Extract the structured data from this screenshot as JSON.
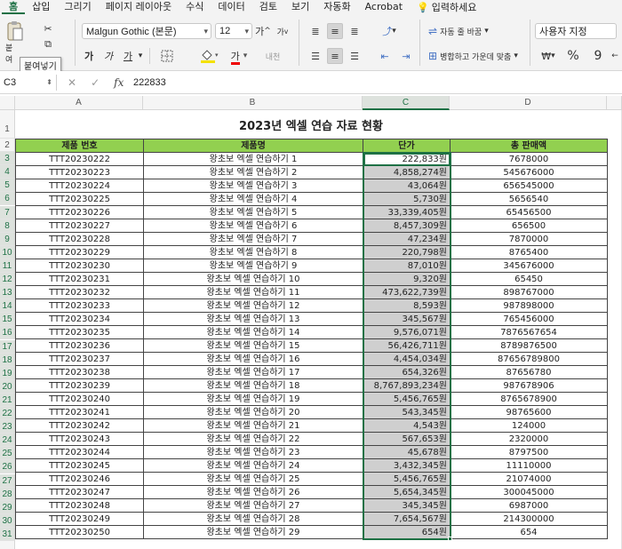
{
  "ribbon": {
    "tabs": [
      "홈",
      "삽입",
      "그리기",
      "페이지 레이아웃",
      "수식",
      "데이터",
      "검토",
      "보기",
      "자동화",
      "Acrobat"
    ],
    "active_tab": 0,
    "search_label": "입력하세요",
    "font_name": "Malgun Gothic (본문)",
    "font_size": "12",
    "grow_font": "가",
    "shrink_font": "가",
    "bold": "가",
    "italic": "가",
    "underline": "가",
    "font_color_letter": "가",
    "phonetic": "내천",
    "wrap_text_label": "자동 줄 바꿈",
    "merge_center_label": "병합하고 가운데 맞춤",
    "number_format": "사용자 지정",
    "paste_label": "붙여",
    "tooltip": "붙여넣기",
    "percent": "%",
    "comma": "9",
    "accent_color": "#1e7145"
  },
  "formula_bar": {
    "cell_ref": "C3",
    "fx": "fx",
    "value": "222833"
  },
  "columns": [
    "A",
    "B",
    "C",
    "D"
  ],
  "sheet": {
    "title": "2023년 엑셀 연습 자료 현황",
    "headers": [
      "제품 번호",
      "제품명",
      "단가",
      "총 판매액"
    ],
    "rows": [
      [
        "TTT20230222",
        "왕초보 엑셀 연습하기 1",
        "222,833원",
        "7678000"
      ],
      [
        "TTT20230223",
        "왕초보 엑셀 연습하기 2",
        "4,858,274원",
        "545676000"
      ],
      [
        "TTT20230224",
        "왕초보 엑셀 연습하기 3",
        "43,064원",
        "656545000"
      ],
      [
        "TTT20230225",
        "왕초보 엑셀 연습하기 4",
        "5,730원",
        "5656540"
      ],
      [
        "TTT20230226",
        "왕초보 엑셀 연습하기 5",
        "33,339,405원",
        "65456500"
      ],
      [
        "TTT20230227",
        "왕초보 엑셀 연습하기 6",
        "8,457,309원",
        "656500"
      ],
      [
        "TTT20230228",
        "왕초보 엑셀 연습하기 7",
        "47,234원",
        "7870000"
      ],
      [
        "TTT20230229",
        "왕초보 엑셀 연습하기 8",
        "220,798원",
        "8765400"
      ],
      [
        "TTT20230230",
        "왕초보 엑셀 연습하기 9",
        "87,010원",
        "345676000"
      ],
      [
        "TTT20230231",
        "왕초보 엑셀 연습하기 10",
        "9,320원",
        "65450"
      ],
      [
        "TTT20230232",
        "왕초보 엑셀 연습하기 11",
        "473,622,739원",
        "898767000"
      ],
      [
        "TTT20230233",
        "왕초보 엑셀 연습하기 12",
        "8,593원",
        "987898000"
      ],
      [
        "TTT20230234",
        "왕초보 엑셀 연습하기 13",
        "345,567원",
        "765456000"
      ],
      [
        "TTT20230235",
        "왕초보 엑셀 연습하기 14",
        "9,576,071원",
        "7876567654"
      ],
      [
        "TTT20230236",
        "왕초보 엑셀 연습하기 15",
        "56,426,711원",
        "8789876500"
      ],
      [
        "TTT20230237",
        "왕초보 엑셀 연습하기 16",
        "4,454,034원",
        "87656789800"
      ],
      [
        "TTT20230238",
        "왕초보 엑셀 연습하기 17",
        "654,326원",
        "87656780"
      ],
      [
        "TTT20230239",
        "왕초보 엑셀 연습하기 18",
        "8,767,893,234원",
        "987678906"
      ],
      [
        "TTT20230240",
        "왕초보 엑셀 연습하기 19",
        "5,456,765원",
        "8765678900"
      ],
      [
        "TTT20230241",
        "왕초보 엑셀 연습하기 20",
        "543,345원",
        "98765600"
      ],
      [
        "TTT20230242",
        "왕초보 엑셀 연습하기 21",
        "4,543원",
        "124000"
      ],
      [
        "TTT20230243",
        "왕초보 엑셀 연습하기 22",
        "567,653원",
        "2320000"
      ],
      [
        "TTT20230244",
        "왕초보 엑셀 연습하기 23",
        "45,678원",
        "8797500"
      ],
      [
        "TTT20230245",
        "왕초보 엑셀 연습하기 24",
        "3,432,345원",
        "11110000"
      ],
      [
        "TTT20230246",
        "왕초보 엑셀 연습하기 25",
        "5,456,765원",
        "21074000"
      ],
      [
        "TTT20230247",
        "왕초보 엑셀 연습하기 26",
        "5,654,345원",
        "300045000"
      ],
      [
        "TTT20230248",
        "왕초보 엑셀 연습하기 27",
        "345,345원",
        "6987000"
      ],
      [
        "TTT20230249",
        "왕초보 엑셀 연습하기 28",
        "7,654,567원",
        "214300000"
      ],
      [
        "TTT20230250",
        "왕초보 엑셀 연습하기 29",
        "654원",
        "654"
      ]
    ]
  }
}
